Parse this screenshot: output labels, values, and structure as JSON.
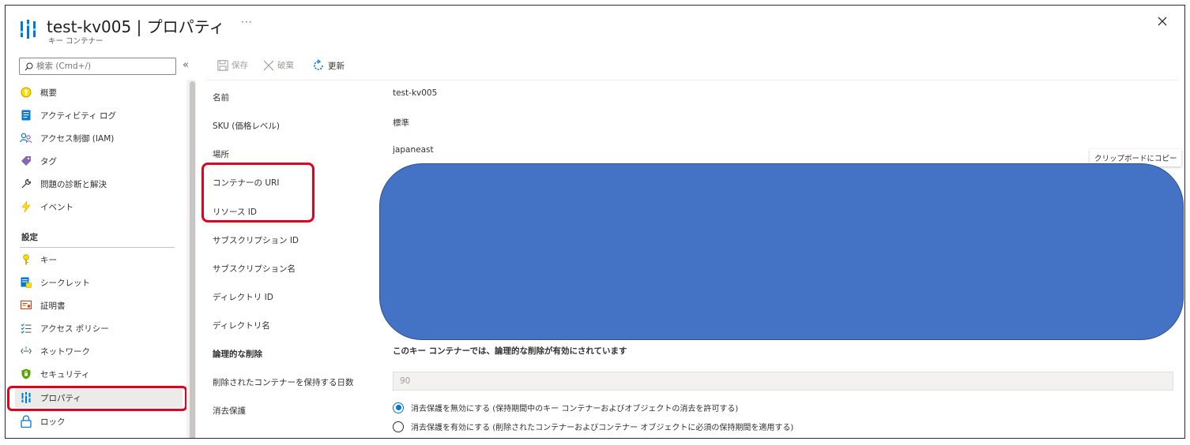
{
  "header": {
    "title": "test-kv005 | プロパティ",
    "subtitle": "キー コンテナー",
    "more_label": "···"
  },
  "sidebar": {
    "search_placeholder": "検索 (Cmd+/)",
    "collapse_label": "«",
    "items": [
      {
        "label": "概要",
        "icon": "key-vault-overview-icon"
      },
      {
        "label": "アクティビティ ログ",
        "icon": "activity-log-icon"
      },
      {
        "label": "アクセス制御 (IAM)",
        "icon": "access-control-icon"
      },
      {
        "label": "タグ",
        "icon": "tag-icon"
      },
      {
        "label": "問題の診断と解決",
        "icon": "wrench-icon"
      },
      {
        "label": "イベント",
        "icon": "lightning-icon"
      }
    ],
    "section_label": "設定",
    "settings_items": [
      {
        "label": "キー",
        "icon": "key-icon"
      },
      {
        "label": "シークレット",
        "icon": "secret-icon"
      },
      {
        "label": "証明書",
        "icon": "certificate-icon"
      },
      {
        "label": "アクセス ポリシー",
        "icon": "access-policy-icon"
      },
      {
        "label": "ネットワーク",
        "icon": "network-icon"
      },
      {
        "label": "セキュリティ",
        "icon": "shield-icon"
      },
      {
        "label": "プロパティ",
        "icon": "properties-icon",
        "active": true
      },
      {
        "label": "ロック",
        "icon": "lock-icon"
      }
    ]
  },
  "toolbar": {
    "save_label": "保存",
    "discard_label": "破棄",
    "refresh_label": "更新"
  },
  "properties": {
    "name_label": "名前",
    "name_value": "test-kv005",
    "sku_label": "SKU (価格レベル)",
    "sku_value": "標準",
    "location_label": "場所",
    "location_value": "japaneast",
    "vault_uri_label": "コンテナーの URI",
    "resource_id_label": "リソース ID",
    "subscription_id_label": "サブスクリプション ID",
    "subscription_name_label": "サブスクリプション名",
    "directory_id_label": "ディレクトリ ID",
    "directory_name_label": "ディレクトリ名",
    "soft_delete_label": "論理的な削除",
    "soft_delete_value": "このキー コンテナーでは、論理的な削除が有効にされています",
    "retention_label": "削除されたコンテナーを保持する日数",
    "retention_value": "90",
    "purge_label": "消去保護",
    "purge_option_disable": "消去保護を無効にする (保持期間中のキー コンテナーおよびオブジェクトの消去を許可する)",
    "purge_option_enable": "消去保護を有効にする (削除されたコンテナーおよびコンテナー オブジェクトに必須の保持期間を適用する)",
    "purge_selected": "disable"
  },
  "copy_tooltip": "クリップボードにコピー",
  "colors": {
    "accent": "#0078d4",
    "highlight": "#e6001f",
    "redaction": "#4472c4"
  }
}
